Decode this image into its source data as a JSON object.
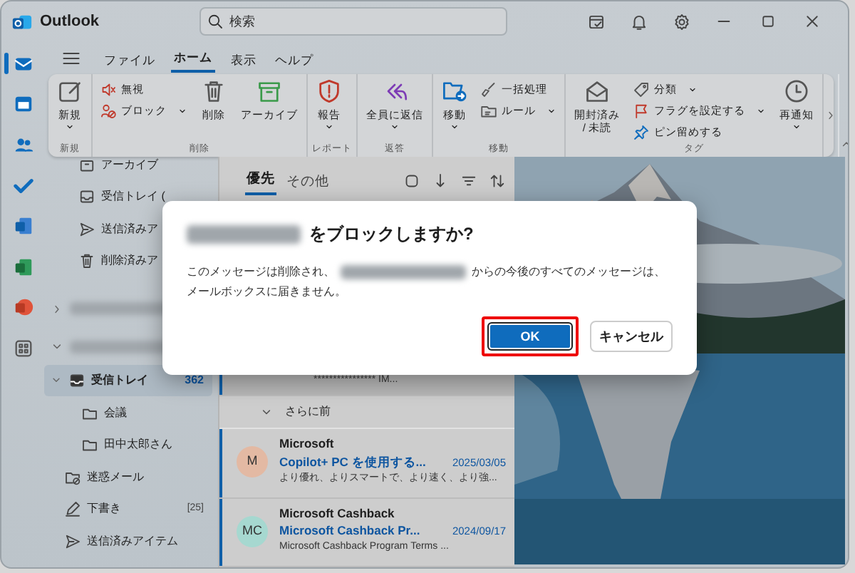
{
  "window": {
    "app_name": "Outlook",
    "search": {
      "placeholder": "検索"
    }
  },
  "app_rail": [
    {
      "selected": true
    },
    {
      "selected": false
    },
    {
      "selected": false
    },
    {
      "selected": false
    },
    {
      "selected": false
    },
    {
      "selected": false
    },
    {
      "selected": false
    },
    {
      "selected": false
    }
  ],
  "menu_tabs": [
    {
      "label": "ファイル",
      "selected": false
    },
    {
      "label": "ホーム",
      "selected": true
    },
    {
      "label": "表示",
      "selected": false
    },
    {
      "label": "ヘルプ",
      "selected": false
    }
  ],
  "ribbon": {
    "groups": [
      {
        "label": "新規",
        "items": [
          {
            "kind": "large",
            "label": "新規",
            "dropdown": true
          }
        ]
      },
      {
        "label": "削除",
        "items": [
          {
            "kind": "small",
            "label": "無視",
            "dropdown": false
          },
          {
            "kind": "small",
            "label": "ブロック",
            "dropdown": true
          },
          {
            "kind": "large",
            "label": "削除",
            "dropdown": false
          },
          {
            "kind": "large",
            "label": "アーカイブ",
            "dropdown": false
          }
        ]
      },
      {
        "label": "レポート",
        "items": [
          {
            "kind": "large",
            "label": "報告",
            "dropdown": true
          }
        ]
      },
      {
        "label": "返答",
        "items": [
          {
            "kind": "large",
            "label": "全員に返信",
            "dropdown": true
          }
        ]
      },
      {
        "label": "移動",
        "items": [
          {
            "kind": "large",
            "label": "移動",
            "dropdown": true
          },
          {
            "kind": "small",
            "label": "一括処理",
            "dropdown": false
          },
          {
            "kind": "small",
            "label": "ルール",
            "dropdown": true
          }
        ]
      },
      {
        "label": "タグ",
        "items": [
          {
            "kind": "large",
            "label": "開封済み / 未読",
            "dropdown": false
          },
          {
            "kind": "small",
            "label": "分類",
            "dropdown": true
          },
          {
            "kind": "small",
            "label": "フラグを設定する",
            "dropdown": true
          },
          {
            "kind": "small",
            "label": "ピン留めする",
            "dropdown": false
          },
          {
            "kind": "large",
            "label": "再通知",
            "dropdown": true
          }
        ]
      }
    ]
  },
  "scrolled_folders": [
    {
      "label": "アーカイブ",
      "selected": false
    },
    {
      "label": "受信トレイ (",
      "selected": false
    },
    {
      "label": "送信済みア",
      "selected": false
    },
    {
      "label": "削除済みア",
      "selected": false
    }
  ],
  "accounts": [
    {
      "expanded": false
    },
    {
      "expanded": true,
      "folders": [
        {
          "label": "受信トレイ",
          "count": "362",
          "selected": true,
          "expanded": true,
          "children": [
            {
              "label": "会議",
              "selected": false
            },
            {
              "label": "田中太郎さん",
              "selected": false
            }
          ]
        },
        {
          "label": "迷惑メール",
          "selected": false
        },
        {
          "label": "下書き",
          "count": "[25]",
          "selected": false
        },
        {
          "label": "送信済みアイテム",
          "selected": false
        }
      ]
    }
  ],
  "message_tabs": [
    {
      "label": "優先",
      "selected": true
    },
    {
      "label": "その他",
      "selected": false
    }
  ],
  "messages_top": [
    {
      "preview": "**************** IM...",
      "selected": true,
      "unread": true
    }
  ],
  "group_header": {
    "label": "さらに前",
    "expanded": true
  },
  "messages": [
    {
      "sender": "Microsoft",
      "initials": "M",
      "color": "#e3b9a3",
      "subject": "Copilot+ PC を使用する...",
      "date": "2025/03/05",
      "preview": "より優れ、よりスマートで、より速く、より強...",
      "unread": true
    },
    {
      "sender": "Microsoft Cashback",
      "initials": "MC",
      "color": "#a6d8d0",
      "subject": "Microsoft Cashback Pr...",
      "date": "2024/09/17",
      "preview": "Microsoft Cashback Program Terms ...",
      "unread": true
    }
  ],
  "dialog": {
    "title_after_name": "をブロックしますか?",
    "message_before": "このメッセージは削除され、",
    "message_after": "からの今後のすべてのメッセージは、メールボックスに届きません。",
    "buttons": [
      {
        "label": "OK",
        "kind": "primary",
        "highlighted": true
      },
      {
        "label": "キャンセル",
        "kind": "secondary",
        "highlighted": false
      }
    ]
  }
}
